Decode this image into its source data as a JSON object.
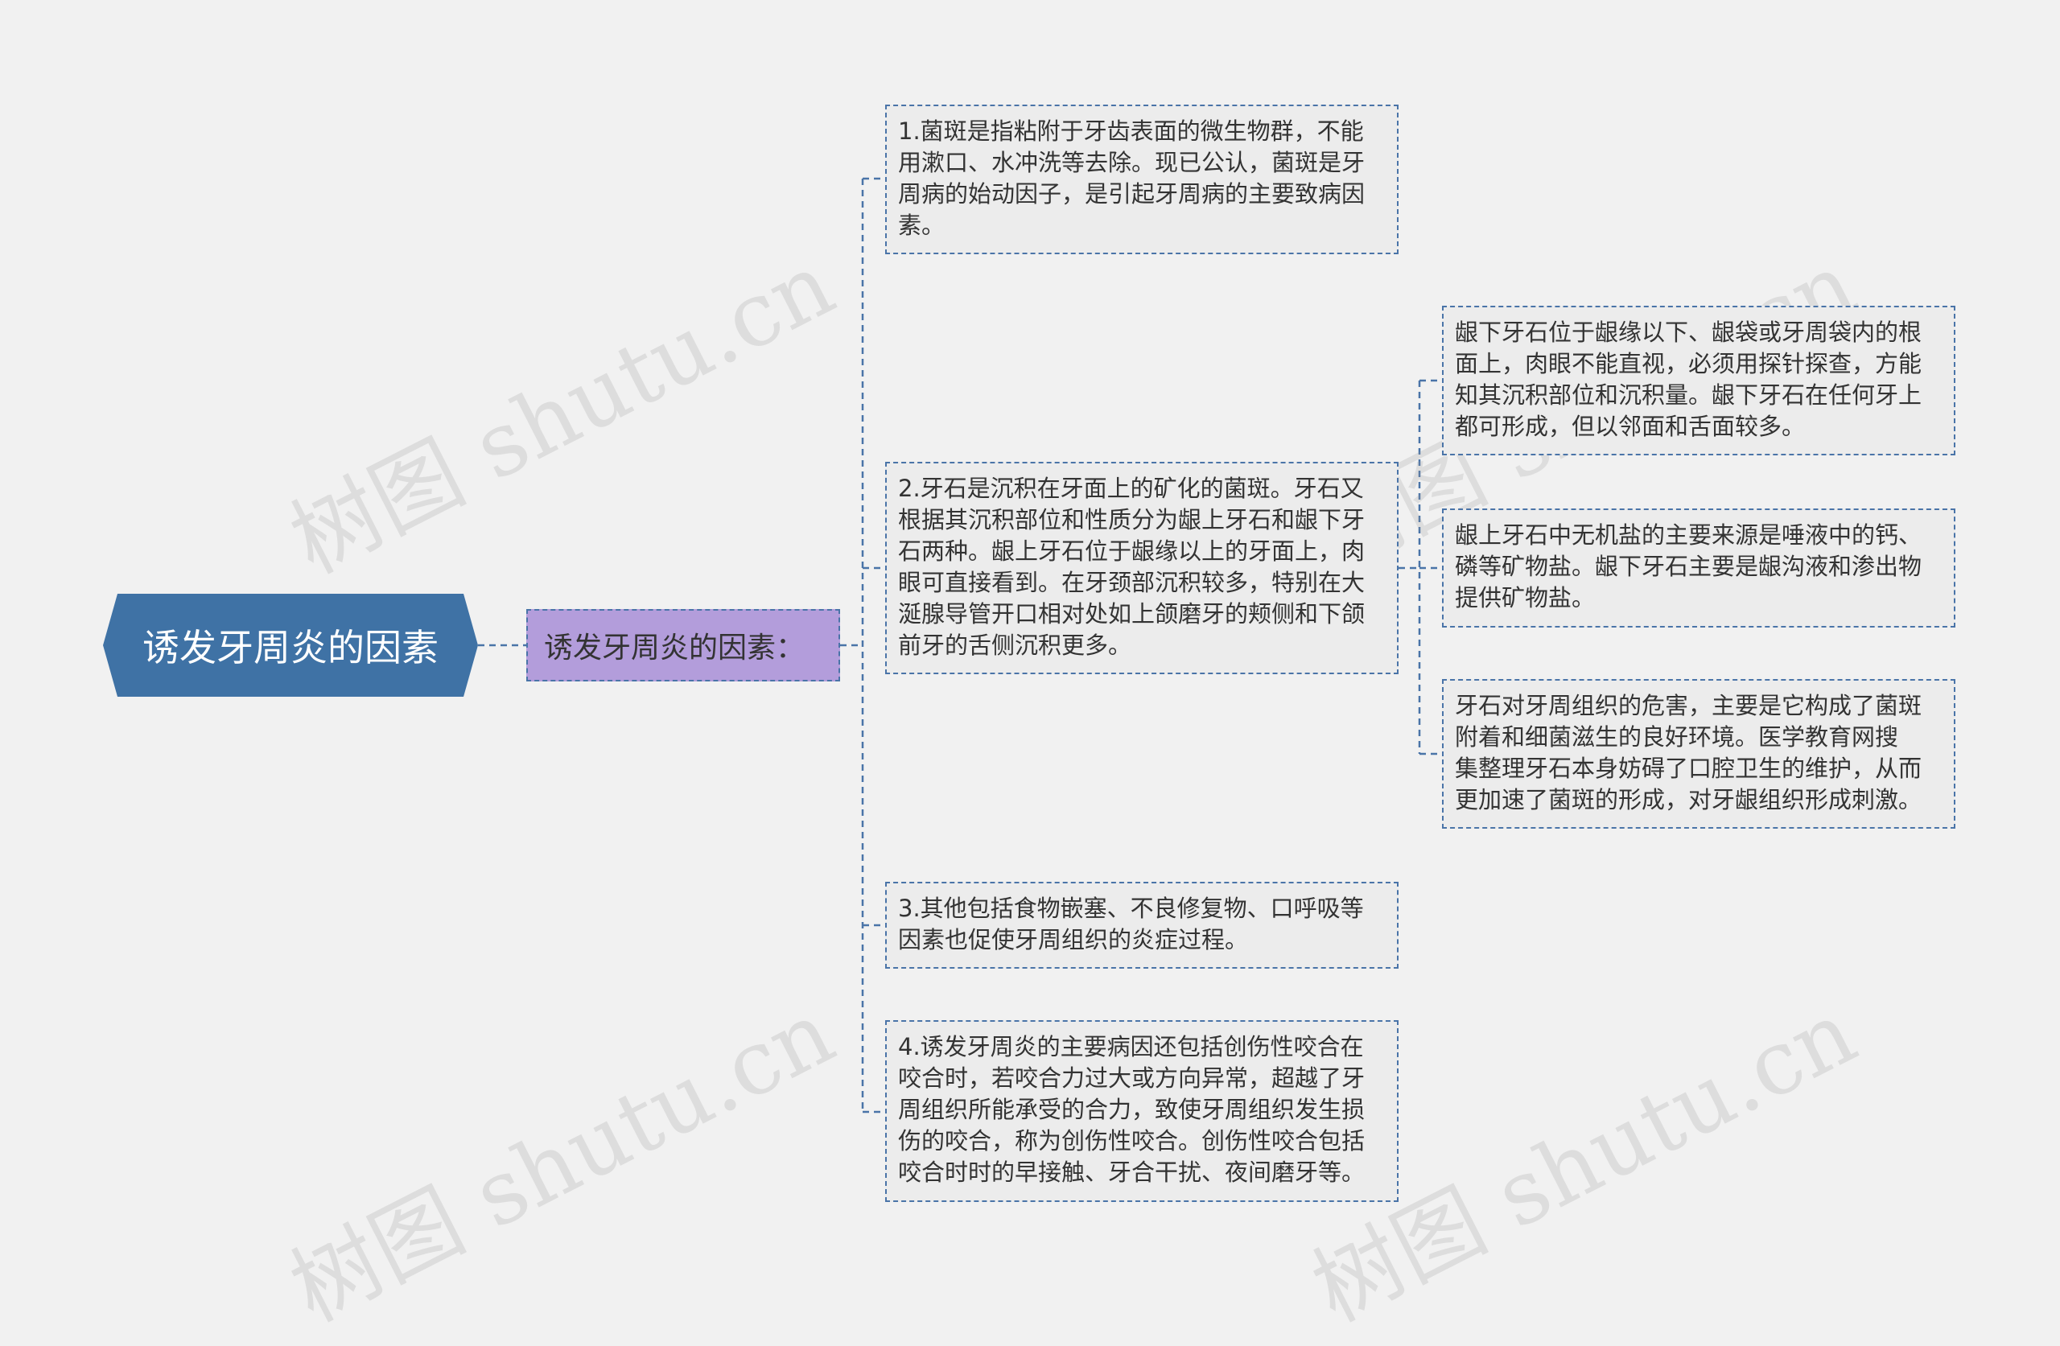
{
  "root": {
    "label": "诱发牙周炎的因素"
  },
  "branch": {
    "label": "诱发牙周炎的因素："
  },
  "leaves": [
    {
      "text": "1.菌斑是指粘附于牙齿表面的微生物群，不能\n用漱口、水冲洗等去除。现已公认，菌斑是牙\n周病的始动因子，是引起牙周病的主要致病因\n素。"
    },
    {
      "text": "2.牙石是沉积在牙面上的矿化的菌斑。牙石又\n根据其沉积部位和性质分为龈上牙石和龈下牙\n石两种。龈上牙石位于龈缘以上的牙面上，肉\n眼可直接看到。在牙颈部沉积较多，特别在大\n涎腺导管开口相对处如上颌磨牙的颊侧和下颌\n前牙的舌侧沉积更多。"
    },
    {
      "text": "3.其他包括食物嵌塞、不良修复物、口呼吸等\n因素也促使牙周组织的炎症过程。"
    },
    {
      "text": "4.诱发牙周炎的主要病因还包括创伤性咬合在\n咬合时，若咬合力过大或方向异常，超越了牙\n周组织所能承受的合力，致使牙周组织发生损\n伤的咬合，称为创伤性咬合。创伤性咬合包括\n咬合时时的早接触、牙合干扰、夜间磨牙等。"
    }
  ],
  "sub_leaves": [
    {
      "text": "龈下牙石位于龈缘以下、龈袋或牙周袋内的根\n面上，肉眼不能直视，必须用探针探查，方能\n知其沉积部位和沉积量。龈下牙石在任何牙上\n都可形成，但以邻面和舌面较多。"
    },
    {
      "text": "龈上牙石中无机盐的主要来源是唾液中的钙、\n磷等矿物盐。龈下牙石主要是龈沟液和渗出物\n提供矿物盐。"
    },
    {
      "text": "牙石对牙周组织的危害，主要是它构成了菌斑\n附着和细菌滋生的良好环境。医学教育网搜\n集整理牙石本身妨碍了口腔卫生的维护，从而\n更加速了菌斑的形成，对牙龈组织形成刺激。"
    }
  ],
  "watermark": "树图 shutu.cn",
  "colors": {
    "root": "#3f72a5",
    "branch": "#b39ddb",
    "connector": "#4a74a8",
    "background": "#f1f1f1"
  }
}
